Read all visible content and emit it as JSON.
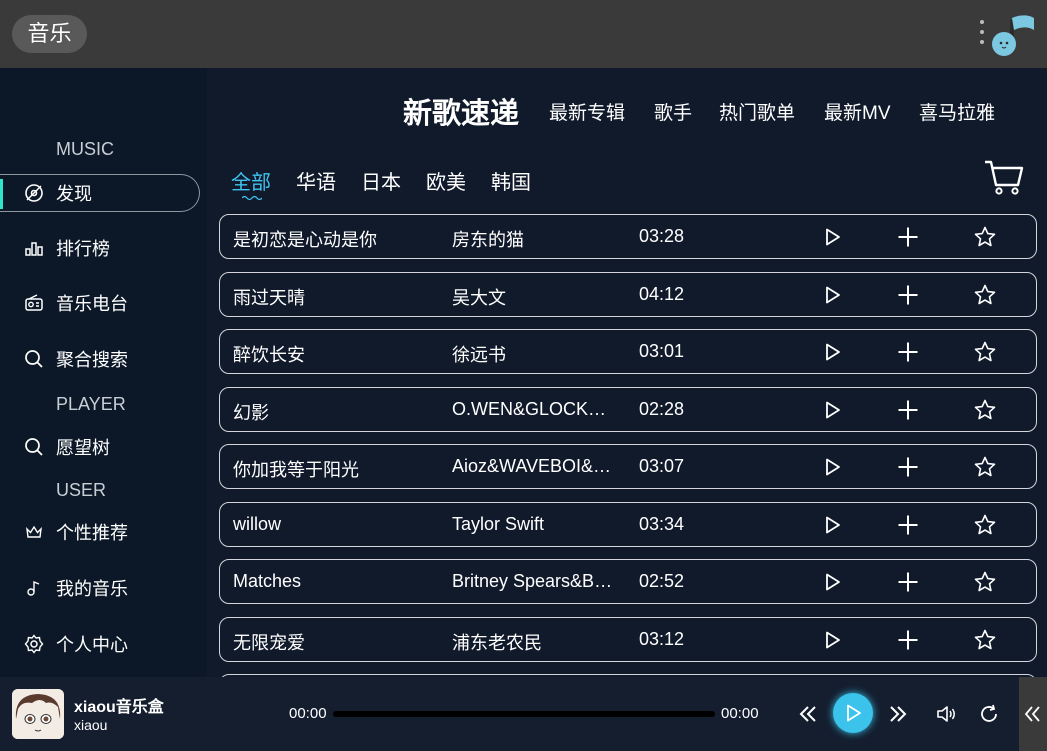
{
  "app": {
    "title": "音乐"
  },
  "sidebar": {
    "section_music": "MUSIC",
    "section_player": "PLAYER",
    "section_user": "USER",
    "items": [
      {
        "label": "发现",
        "icon": "disc-icon",
        "active": true
      },
      {
        "label": "排行榜",
        "icon": "chart-icon"
      },
      {
        "label": "音乐电台",
        "icon": "radio-icon"
      },
      {
        "label": "聚合搜索",
        "icon": "search-icon"
      },
      {
        "label": "愿望树",
        "icon": "search-icon"
      },
      {
        "label": "个性推荐",
        "icon": "crown-icon"
      },
      {
        "label": "我的音乐",
        "icon": "note-icon"
      },
      {
        "label": "个人中心",
        "icon": "gear-icon"
      }
    ]
  },
  "topnav": {
    "items": [
      {
        "label": "新歌速递",
        "active": true
      },
      {
        "label": "最新专辑"
      },
      {
        "label": "歌手"
      },
      {
        "label": "热门歌单"
      },
      {
        "label": "最新MV"
      },
      {
        "label": "喜马拉雅"
      }
    ]
  },
  "categories": [
    {
      "label": "全部",
      "active": true
    },
    {
      "label": "华语"
    },
    {
      "label": "日本"
    },
    {
      "label": "欧美"
    },
    {
      "label": "韩国"
    }
  ],
  "songs": [
    {
      "title": "是初恋是心动是你",
      "artist": "房东的猫",
      "duration": "03:28"
    },
    {
      "title": "雨过天晴",
      "artist": "吴大文",
      "duration": "04:12"
    },
    {
      "title": "醉饮长安",
      "artist": "徐远书",
      "duration": "03:01"
    },
    {
      "title": "幻影",
      "artist": "O.WEN&GLOCK…",
      "duration": "02:28"
    },
    {
      "title": "你加我等于阳光",
      "artist": "Aioz&WAVEBOI&h…",
      "duration": "03:07"
    },
    {
      "title": "willow",
      "artist": "Taylor Swift",
      "duration": "03:34"
    },
    {
      "title": "Matches",
      "artist": "Britney Spears&B…",
      "duration": "02:52"
    },
    {
      "title": "无限宠爱",
      "artist": "浦东老农民",
      "duration": "03:12"
    }
  ],
  "player": {
    "song_name": "xiaou音乐盒",
    "artist": "xiaou",
    "current_time": "00:00",
    "total_time": "00:00",
    "progress": 0
  },
  "colors": {
    "accent": "#3cc3eb",
    "active_bar": "#2ee6c9"
  }
}
